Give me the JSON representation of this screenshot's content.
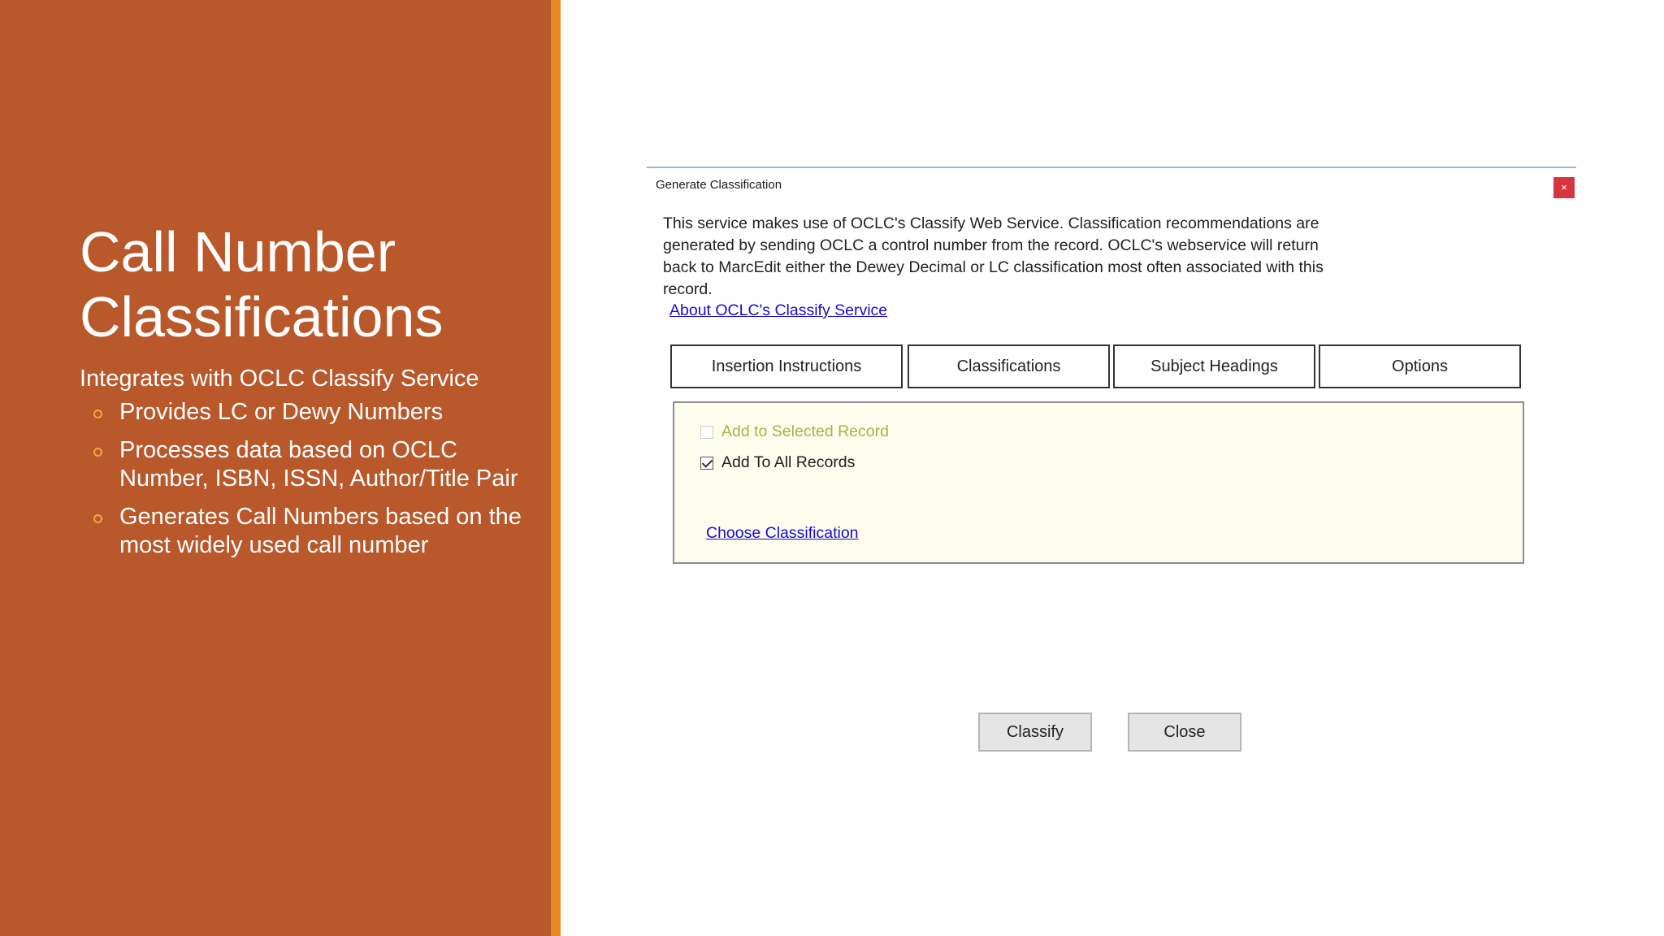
{
  "slide": {
    "title_line1": "Call Number",
    "title_line2": "Classifications",
    "lead": "Integrates with OCLC Classify Service",
    "bullets": [
      "Provides LC or Dewy Numbers",
      "Processes data based on OCLC Number, ISBN, ISSN, Author/Title Pair",
      "Generates Call Numbers based on the most widely used call number"
    ]
  },
  "dialog": {
    "title": "Generate Classification",
    "close_glyph": "×",
    "description": "This service makes use of OCLC's Classify Web Service.  Classification recommendations are generated by sending OCLC a control number from the record.  OCLC's webservice will return back to MarcEdit either the Dewey Decimal or LC classification most often associated with this record.",
    "about_link": "About OCLC's Classify Service",
    "tabs": [
      "Insertion Instructions",
      "Classifications",
      "Subject Headings",
      "Options"
    ],
    "options": {
      "add_selected": {
        "label": "Add to Selected Record",
        "checked": false,
        "enabled": false
      },
      "add_all": {
        "label": "Add To All Records",
        "checked": true,
        "enabled": true
      }
    },
    "choose_link": "Choose Classification",
    "buttons": {
      "classify": "Classify",
      "close": "Close"
    }
  },
  "colors": {
    "panel_bg": "#b9582b",
    "accent": "#e58a1f",
    "link": "#1a0dcc",
    "close_button": "#d5353f"
  }
}
